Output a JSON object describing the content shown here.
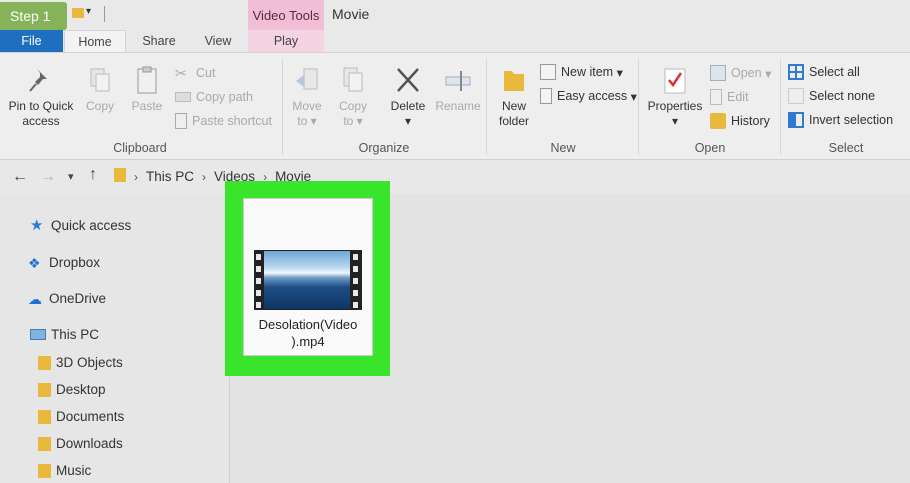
{
  "step_badge": "Step 1",
  "window": {
    "contextual_tab": "Video Tools",
    "title": "Movie"
  },
  "tabs": {
    "file": "File",
    "home": "Home",
    "share": "Share",
    "view": "View",
    "play": "Play"
  },
  "ribbon": {
    "clipboard": {
      "label": "Clipboard",
      "pin_line1": "Pin to Quick",
      "pin_line2": "access",
      "copy": "Copy",
      "paste": "Paste",
      "cut": "Cut",
      "copy_path": "Copy path",
      "paste_shortcut": "Paste shortcut"
    },
    "organize": {
      "label": "Organize",
      "move_line1": "Move",
      "move_line2": "to",
      "copy_line1": "Copy",
      "copy_line2": "to",
      "delete": "Delete",
      "rename": "Rename"
    },
    "new": {
      "label": "New",
      "new_folder_line1": "New",
      "new_folder_line2": "folder",
      "new_item": "New item",
      "easy_access": "Easy access"
    },
    "open": {
      "label": "Open",
      "properties": "Properties",
      "open": "Open",
      "edit": "Edit",
      "history": "History"
    },
    "select": {
      "label": "Select",
      "select_all": "Select all",
      "select_none": "Select none",
      "invert_selection": "Invert selection"
    }
  },
  "address": {
    "crumbs": [
      "This PC",
      "Videos",
      "Movie"
    ]
  },
  "nav_pane": {
    "items": [
      "Quick access",
      "Dropbox",
      "OneDrive",
      "This PC",
      "3D Objects",
      "Desktop",
      "Documents",
      "Downloads",
      "Music"
    ]
  },
  "file": {
    "name_line1": "Desolation(Video",
    "name_line2": ").mp4"
  },
  "colors": {
    "file_tab": "#1f6fc0",
    "contextual_tab": "#f0bfd5",
    "highlight": "#39e52a",
    "step_badge": "#86b35a"
  }
}
